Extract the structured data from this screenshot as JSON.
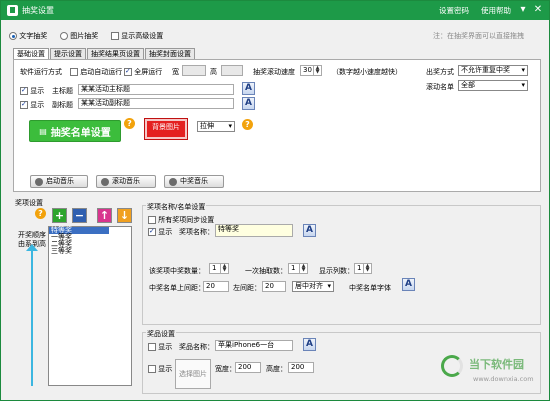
{
  "window": {
    "title": "抽奖设置",
    "link_password": "设置密码",
    "link_help": "使用帮助",
    "min": "▾",
    "close": "✕"
  },
  "mode": {
    "text_label": "文字抽奖",
    "image_label": "图片抽奖",
    "advanced_label": "显示高级设置",
    "hint": "注：在抽奖界面可以直接拖拽",
    "text_checked": true,
    "image_checked": false,
    "advanced_checked": false
  },
  "tabs": [
    {
      "label": "基础设置",
      "active": true
    },
    {
      "label": "提示设置",
      "active": false
    },
    {
      "label": "抽奖结果页设置",
      "active": false
    },
    {
      "label": "抽奖封面设置",
      "active": false
    }
  ],
  "basic": {
    "run_mode_label": "软件运行方式",
    "autostart_label": "启动自动运行",
    "autostart_checked": false,
    "fullscreen_label": "全屏运行",
    "fullscreen_checked": true,
    "width_label": "宽",
    "width_value": "",
    "height_label": "高",
    "height_value": "",
    "scroll_speed_label": "抽奖滚动速度",
    "scroll_speed_value": "30",
    "scroll_speed_hint": "（数字越小速度越快）",
    "output_mode_label": "出奖方式",
    "output_mode_value": "不允许重复中奖",
    "scroll_list_label": "滚动名单",
    "scroll_list_value": "全部",
    "show_label": "显示",
    "main_title_label": "主标题",
    "main_title_value": "某某活动主标题",
    "main_title_checked": true,
    "sub_title_label": "副标题",
    "sub_title_value": "某某活动副标题",
    "sub_title_checked": true,
    "font_btn": "A",
    "list_button": "抽奖名单设置",
    "bg_button": "背景图片",
    "stretch_value": "拉伸",
    "music_start": "启动音乐",
    "music_scroll": "滚动音乐",
    "music_win": "中奖音乐",
    "help_icon": "?"
  },
  "prize": {
    "section_label": "奖项设置",
    "order_label_1": "开奖顺序",
    "order_label_2": "由系到高",
    "add": "+",
    "remove": "−",
    "up": "↑",
    "down": "↓",
    "list": [
      "特等奖",
      "一等奖",
      "二等奖",
      "三等奖"
    ],
    "selected_index": 0,
    "name_section_label": "奖项名称/名单设置",
    "sync_label": "所有奖项同步设置",
    "sync_checked": false,
    "show_label": "显示",
    "show_checked": true,
    "name_label": "奖项名称：",
    "name_value": "特等奖",
    "quota_label": "该奖项中奖数量：",
    "quota_value": "1",
    "per_draw_label": "一次抽取数：",
    "per_draw_value": "1",
    "columns_label": "显示列数：",
    "columns_value": "1",
    "top_margin_label": "中奖名单上间距：",
    "top_margin_value": "20",
    "left_margin_label": "左间距：",
    "left_margin_value": "20",
    "align_value": "居中对齐",
    "font_label": "中奖名单字体",
    "goods_section_label": "奖品设置",
    "goods_show_label": "显示",
    "goods_show_checked": false,
    "goods_name_label": "奖品名称：",
    "goods_name_value": "苹果iPhone6一台",
    "goods_img_show_label": "显示",
    "goods_img_checked": false,
    "goods_img_button": "选择图片",
    "goods_width_label": "宽度：",
    "goods_width_value": "200",
    "goods_height_label": "高度：",
    "goods_height_value": "200"
  },
  "watermark": {
    "brand": "当下软件园",
    "url": "www.downxia.com"
  }
}
